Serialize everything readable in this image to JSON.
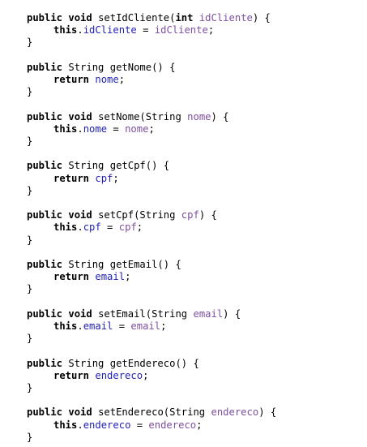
{
  "code": {
    "lines": [
      [
        {
          "t": "public",
          "c": "kw"
        },
        {
          "t": " ",
          "c": "plain"
        },
        {
          "t": "void",
          "c": "kw"
        },
        {
          "t": " setIdCliente(",
          "c": "plain"
        },
        {
          "t": "int",
          "c": "kw"
        },
        {
          "t": " ",
          "c": "plain"
        },
        {
          "t": "idCliente",
          "c": "param"
        },
        {
          "t": ") {",
          "c": "plain"
        }
      ],
      [
        {
          "t": "this",
          "c": "kw"
        },
        {
          "t": ".",
          "c": "plain"
        },
        {
          "t": "idCliente",
          "c": "field"
        },
        {
          "t": " = ",
          "c": "plain"
        },
        {
          "t": "idCliente",
          "c": "param"
        },
        {
          "t": ";",
          "c": "plain"
        }
      ],
      [
        {
          "t": "}",
          "c": "plain"
        }
      ],
      [],
      [
        {
          "t": "public",
          "c": "kw"
        },
        {
          "t": " String getNome() {",
          "c": "plain"
        }
      ],
      [
        {
          "t": "return",
          "c": "kw"
        },
        {
          "t": " ",
          "c": "plain"
        },
        {
          "t": "nome",
          "c": "field"
        },
        {
          "t": ";",
          "c": "plain"
        }
      ],
      [
        {
          "t": "}",
          "c": "plain"
        }
      ],
      [],
      [
        {
          "t": "public",
          "c": "kw"
        },
        {
          "t": " ",
          "c": "plain"
        },
        {
          "t": "void",
          "c": "kw"
        },
        {
          "t": " setNome(String ",
          "c": "plain"
        },
        {
          "t": "nome",
          "c": "param"
        },
        {
          "t": ") {",
          "c": "plain"
        }
      ],
      [
        {
          "t": "this",
          "c": "kw"
        },
        {
          "t": ".",
          "c": "plain"
        },
        {
          "t": "nome",
          "c": "field"
        },
        {
          "t": " = ",
          "c": "plain"
        },
        {
          "t": "nome",
          "c": "param"
        },
        {
          "t": ";",
          "c": "plain"
        }
      ],
      [
        {
          "t": "}",
          "c": "plain"
        }
      ],
      [],
      [
        {
          "t": "public",
          "c": "kw"
        },
        {
          "t": " String getCpf() {",
          "c": "plain"
        }
      ],
      [
        {
          "t": "return",
          "c": "kw"
        },
        {
          "t": " ",
          "c": "plain"
        },
        {
          "t": "cpf",
          "c": "field"
        },
        {
          "t": ";",
          "c": "plain"
        }
      ],
      [
        {
          "t": "}",
          "c": "plain"
        }
      ],
      [],
      [
        {
          "t": "public",
          "c": "kw"
        },
        {
          "t": " ",
          "c": "plain"
        },
        {
          "t": "void",
          "c": "kw"
        },
        {
          "t": " setCpf(String ",
          "c": "plain"
        },
        {
          "t": "cpf",
          "c": "param"
        },
        {
          "t": ") {",
          "c": "plain"
        }
      ],
      [
        {
          "t": "this",
          "c": "kw"
        },
        {
          "t": ".",
          "c": "plain"
        },
        {
          "t": "cpf",
          "c": "field"
        },
        {
          "t": " = ",
          "c": "plain"
        },
        {
          "t": "cpf",
          "c": "param"
        },
        {
          "t": ";",
          "c": "plain"
        }
      ],
      [
        {
          "t": "}",
          "c": "plain"
        }
      ],
      [],
      [
        {
          "t": "public",
          "c": "kw"
        },
        {
          "t": " String getEmail() {",
          "c": "plain"
        }
      ],
      [
        {
          "t": "return",
          "c": "kw"
        },
        {
          "t": " ",
          "c": "plain"
        },
        {
          "t": "email",
          "c": "field"
        },
        {
          "t": ";",
          "c": "plain"
        }
      ],
      [
        {
          "t": "}",
          "c": "plain"
        }
      ],
      [],
      [
        {
          "t": "public",
          "c": "kw"
        },
        {
          "t": " ",
          "c": "plain"
        },
        {
          "t": "void",
          "c": "kw"
        },
        {
          "t": " setEmail(String ",
          "c": "plain"
        },
        {
          "t": "email",
          "c": "param"
        },
        {
          "t": ") {",
          "c": "plain"
        }
      ],
      [
        {
          "t": "this",
          "c": "kw"
        },
        {
          "t": ".",
          "c": "plain"
        },
        {
          "t": "email",
          "c": "field"
        },
        {
          "t": " = ",
          "c": "plain"
        },
        {
          "t": "email",
          "c": "param"
        },
        {
          "t": ";",
          "c": "plain"
        }
      ],
      [
        {
          "t": "}",
          "c": "plain"
        }
      ],
      [],
      [
        {
          "t": "public",
          "c": "kw"
        },
        {
          "t": " String getEndereco() {",
          "c": "plain"
        }
      ],
      [
        {
          "t": "return",
          "c": "kw"
        },
        {
          "t": " ",
          "c": "plain"
        },
        {
          "t": "endereco",
          "c": "field"
        },
        {
          "t": ";",
          "c": "plain"
        }
      ],
      [
        {
          "t": "}",
          "c": "plain"
        }
      ],
      [],
      [
        {
          "t": "public",
          "c": "kw"
        },
        {
          "t": " ",
          "c": "plain"
        },
        {
          "t": "void",
          "c": "kw"
        },
        {
          "t": " setEndereco(String ",
          "c": "plain"
        },
        {
          "t": "endereco",
          "c": "param"
        },
        {
          "t": ") {",
          "c": "plain"
        }
      ],
      [
        {
          "t": "this",
          "c": "kw"
        },
        {
          "t": ".",
          "c": "plain"
        },
        {
          "t": "endereco",
          "c": "field"
        },
        {
          "t": " = ",
          "c": "plain"
        },
        {
          "t": "endereco",
          "c": "param"
        },
        {
          "t": ";",
          "c": "plain"
        }
      ],
      [
        {
          "t": "}",
          "c": "plain"
        }
      ]
    ]
  },
  "colors": {
    "keyword": "#000000",
    "field": "#1f1fb4",
    "parameter": "#7d4fa0",
    "text": "#000000",
    "background": "#ffffff"
  }
}
